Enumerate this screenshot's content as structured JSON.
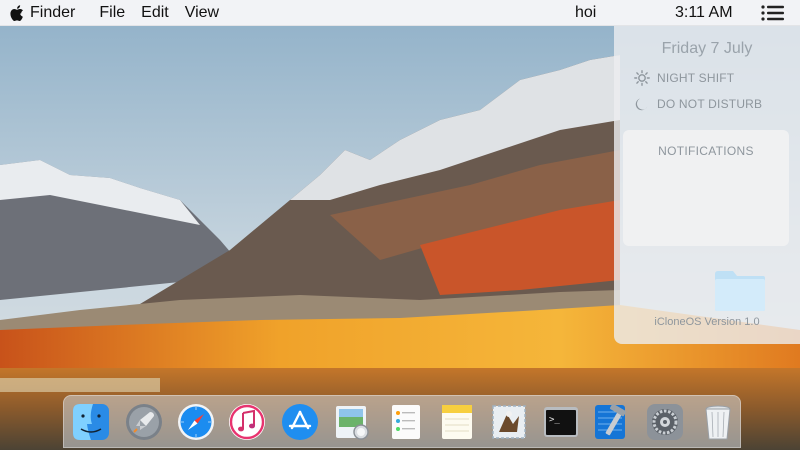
{
  "menubar": {
    "app_name": "Finder",
    "menus": [
      "File",
      "Edit",
      "View"
    ],
    "user": "hoi",
    "time": "3:11 AM"
  },
  "notification_center": {
    "date": "Friday 7 July",
    "night_shift": "NIGHT SHIFT",
    "do_not_disturb": "DO NOT DISTURB",
    "notifications_title": "NOTIFICATIONS",
    "version": "iCloneOS Version 1.0"
  },
  "dock": {
    "apps": [
      "Finder",
      "Launchpad",
      "Safari",
      "iTunes",
      "App Store",
      "Preview",
      "Reminders",
      "Notes",
      "Mail",
      "Terminal",
      "Xcode",
      "System Preferences",
      "Trash"
    ]
  }
}
